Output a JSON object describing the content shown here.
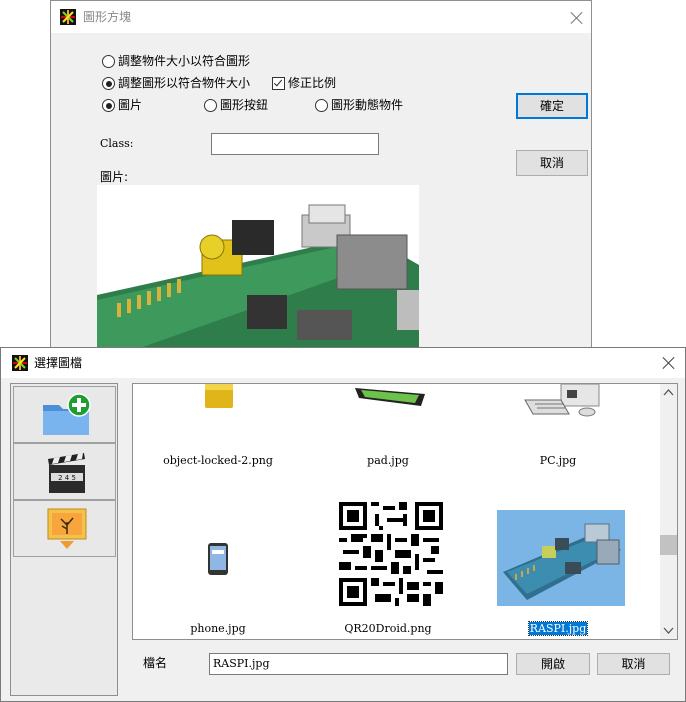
{
  "graphic_dialog": {
    "title": "圖形方塊",
    "options": {
      "fit_graphic_to_object": "調整物件大小以符合圖形",
      "fit_object_to_graphic": "調整圖形以符合物件大小",
      "keep_ratio": "修正比例",
      "picture": "圖片",
      "graphic_button": "圖形按鈕",
      "graphic_animated": "圖形動態物件"
    },
    "ok_label": "確定",
    "cancel_label": "取消",
    "class_label": "Class:",
    "class_value": "",
    "picture_label": "圖片:"
  },
  "file_dialog": {
    "title": "選擇圖檔",
    "files": [
      {
        "name": "object-locked-2.png"
      },
      {
        "name": "pad.jpg"
      },
      {
        "name": "PC.jpg"
      },
      {
        "name": "phone.jpg"
      },
      {
        "name": "QR20Droid.png"
      },
      {
        "name": "RASPI.jpg",
        "selected": true
      }
    ],
    "filename_label": "檔名",
    "filename_value": "RASPI.jpg",
    "open_label": "開啟",
    "cancel_label": "取消",
    "side_icons": [
      "add-folder-icon",
      "clapper-board-icon",
      "image-icon"
    ],
    "side_clapper_digits": "2 4 5"
  },
  "colors": {
    "accent": "#0078d7",
    "thumb_selected_bg": "#0078d7"
  }
}
